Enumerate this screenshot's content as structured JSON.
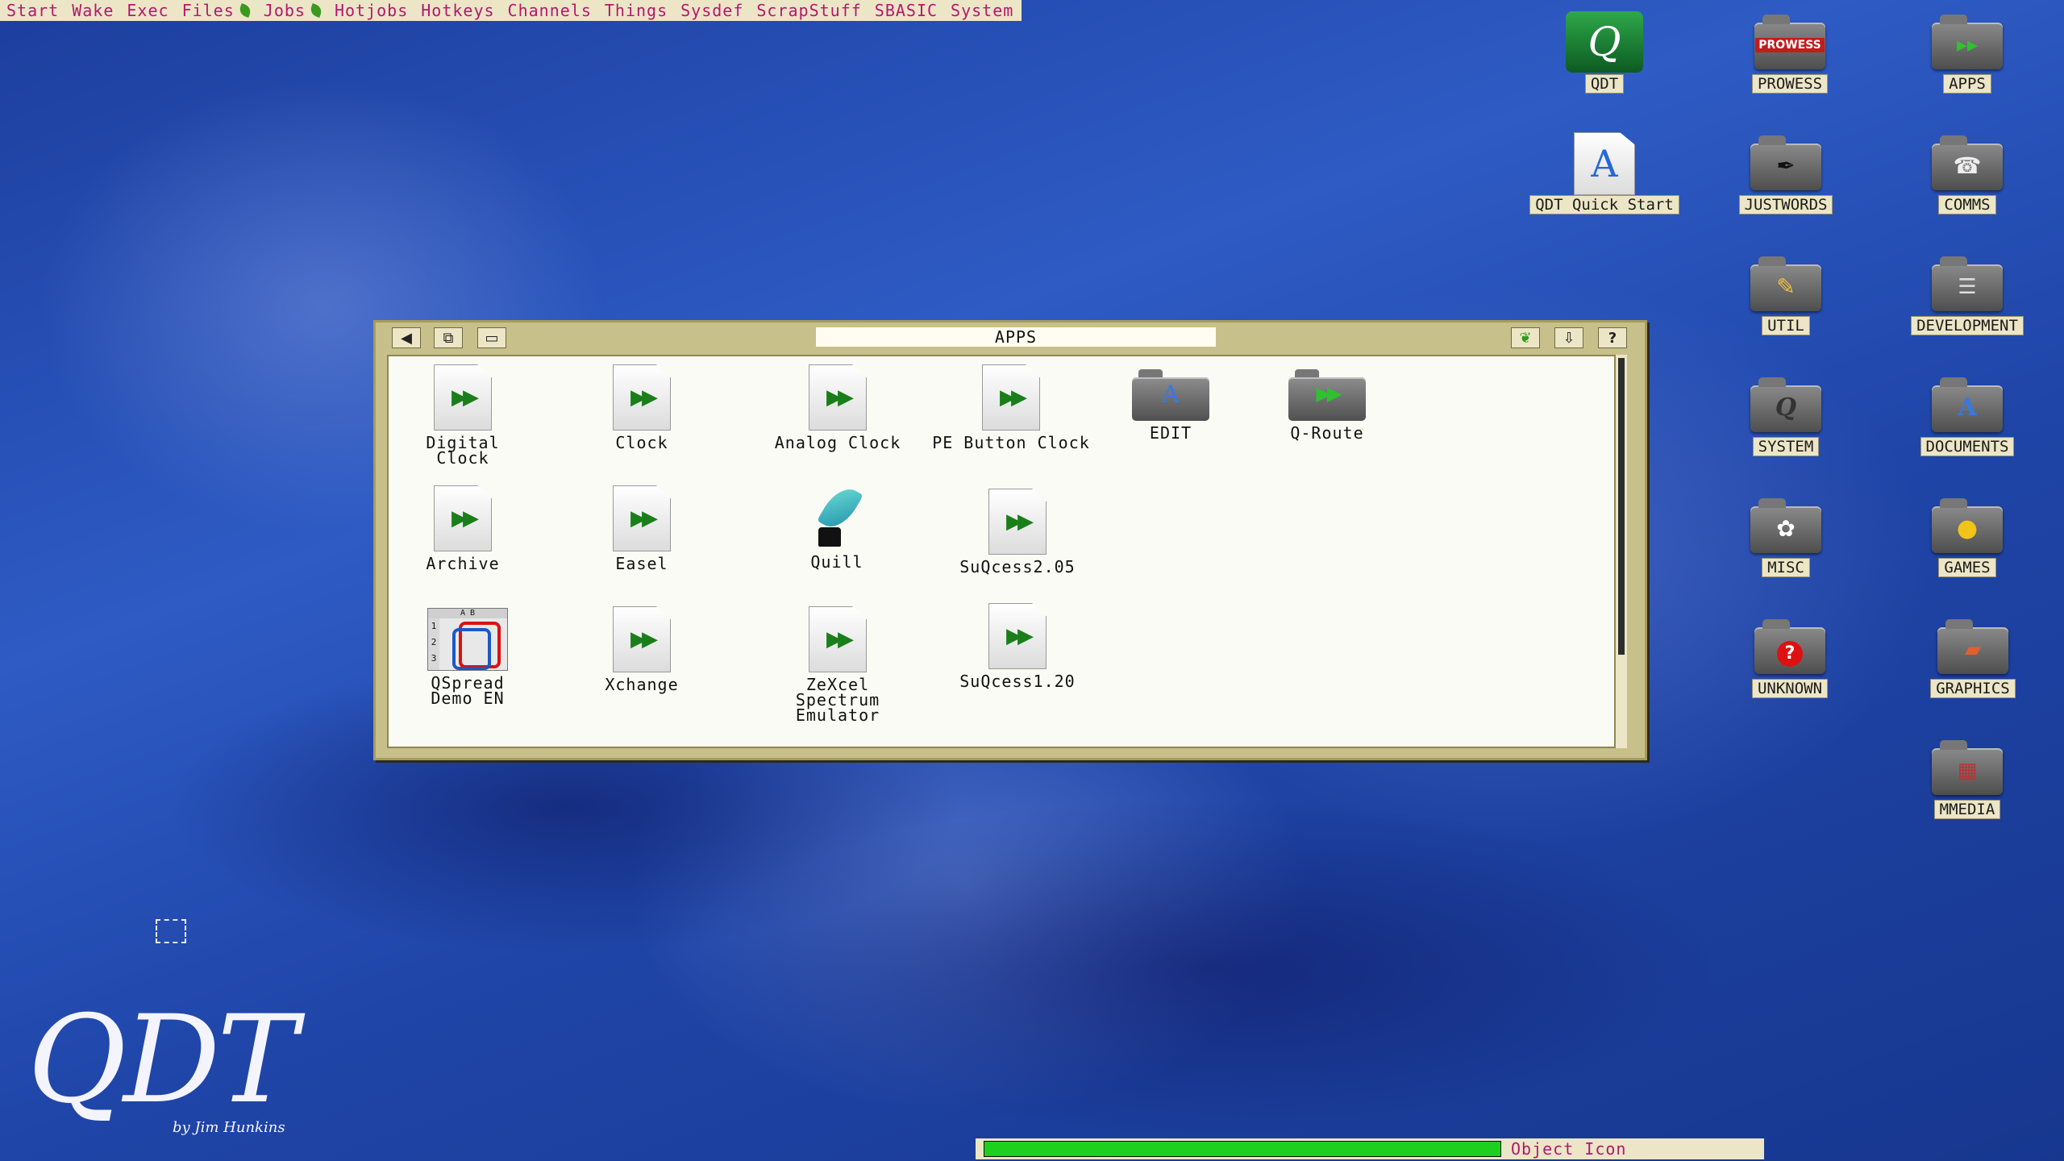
{
  "menubar": {
    "items": [
      {
        "label": "Start",
        "leaf": false
      },
      {
        "label": "Wake",
        "leaf": false
      },
      {
        "label": "Exec",
        "leaf": false
      },
      {
        "label": "Files",
        "leaf": true
      },
      {
        "label": "Jobs",
        "leaf": true
      },
      {
        "label": "Hotjobs",
        "leaf": false
      },
      {
        "label": "Hotkeys",
        "leaf": false
      },
      {
        "label": "Channels",
        "leaf": false
      },
      {
        "label": "Things",
        "leaf": false
      },
      {
        "label": "Sysdef",
        "leaf": false
      },
      {
        "label": "ScrapStuff",
        "leaf": false
      },
      {
        "label": "SBASIC",
        "leaf": false
      },
      {
        "label": "System",
        "leaf": false
      }
    ]
  },
  "desktop": {
    "icons": [
      {
        "label": "QDT",
        "icon": "qdt-logo-icon"
      },
      {
        "label": "PROWESS",
        "icon": "prowess-folder-icon"
      },
      {
        "label": "APPS",
        "icon": "apps-folder-icon"
      },
      {
        "label": "QDT Quick Start",
        "icon": "document-a-icon"
      },
      {
        "label": "JUSTWORDS",
        "icon": "justwords-folder-icon"
      },
      {
        "label": "COMMS",
        "icon": "comms-folder-icon"
      },
      {
        "label": "UTIL",
        "icon": "util-folder-icon"
      },
      {
        "label": "DEVELOPMENT",
        "icon": "development-folder-icon"
      },
      {
        "label": "SYSTEM",
        "icon": "system-folder-icon"
      },
      {
        "label": "DOCUMENTS",
        "icon": "documents-folder-icon"
      },
      {
        "label": "MISC",
        "icon": "misc-folder-icon"
      },
      {
        "label": "GAMES",
        "icon": "games-folder-icon"
      },
      {
        "label": "UNKNOWN",
        "icon": "unknown-folder-icon"
      },
      {
        "label": "GRAPHICS",
        "icon": "graphics-folder-icon"
      },
      {
        "label": "MMEDIA",
        "icon": "mmedia-folder-icon"
      }
    ],
    "prowess_badge": "PROWESS"
  },
  "window": {
    "title": "APPS",
    "items": [
      {
        "label": "Digital Clock",
        "icon": "executable-icon"
      },
      {
        "label": "Clock",
        "icon": "executable-icon"
      },
      {
        "label": "Analog Clock",
        "icon": "executable-icon"
      },
      {
        "label": "PE Button Clock",
        "icon": "executable-icon"
      },
      {
        "label": "EDIT",
        "icon": "edit-folder-icon"
      },
      {
        "label": "Q-Route",
        "icon": "q-route-folder-icon"
      },
      {
        "label": "Archive",
        "icon": "executable-icon"
      },
      {
        "label": "Easel",
        "icon": "executable-icon"
      },
      {
        "label": "Quill",
        "icon": "quill-icon"
      },
      {
        "label": "SuQcess2.05",
        "icon": "executable-icon"
      },
      {
        "label": "QSpread\nDemo EN",
        "icon": "qspread-icon"
      },
      {
        "label": "Xchange",
        "icon": "executable-icon"
      },
      {
        "label": "ZeXcel\nSpectrum\nEmulator",
        "icon": "executable-icon"
      },
      {
        "label": "SuQcess1.20",
        "icon": "executable-icon"
      }
    ]
  },
  "statusbar": {
    "text": "Object Icon"
  },
  "logo": {
    "text": "QDT",
    "byline": "by Jim Hunkins"
  },
  "colors": {
    "menu_text": "#b5176e",
    "menu_bg": "#ece6c6",
    "window_frame": "#c8c08a",
    "progress": "#1ed01e"
  }
}
